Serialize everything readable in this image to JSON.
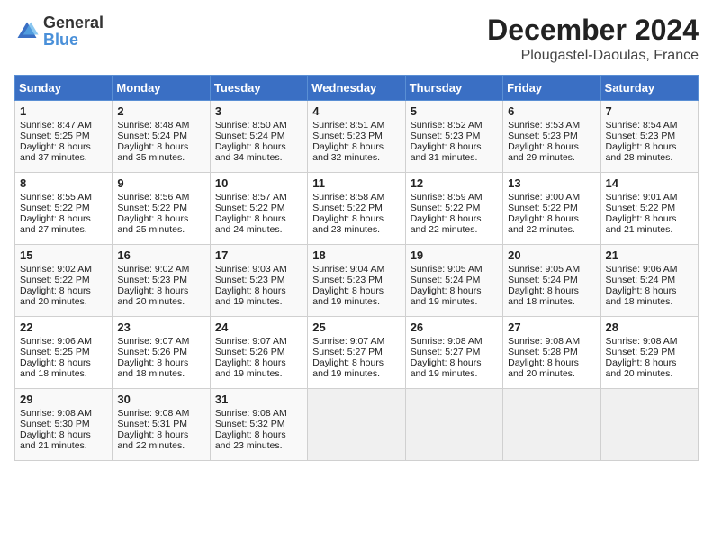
{
  "header": {
    "logo_general": "General",
    "logo_blue": "Blue",
    "month": "December 2024",
    "location": "Plougastel-Daoulas, France"
  },
  "days_of_week": [
    "Sunday",
    "Monday",
    "Tuesday",
    "Wednesday",
    "Thursday",
    "Friday",
    "Saturday"
  ],
  "weeks": [
    [
      {
        "day": 1,
        "sunrise": "8:47 AM",
        "sunset": "5:25 PM",
        "daylight": "8 hours and 37 minutes."
      },
      {
        "day": 2,
        "sunrise": "8:48 AM",
        "sunset": "5:24 PM",
        "daylight": "8 hours and 35 minutes."
      },
      {
        "day": 3,
        "sunrise": "8:50 AM",
        "sunset": "5:24 PM",
        "daylight": "8 hours and 34 minutes."
      },
      {
        "day": 4,
        "sunrise": "8:51 AM",
        "sunset": "5:23 PM",
        "daylight": "8 hours and 32 minutes."
      },
      {
        "day": 5,
        "sunrise": "8:52 AM",
        "sunset": "5:23 PM",
        "daylight": "8 hours and 31 minutes."
      },
      {
        "day": 6,
        "sunrise": "8:53 AM",
        "sunset": "5:23 PM",
        "daylight": "8 hours and 29 minutes."
      },
      {
        "day": 7,
        "sunrise": "8:54 AM",
        "sunset": "5:23 PM",
        "daylight": "8 hours and 28 minutes."
      }
    ],
    [
      {
        "day": 8,
        "sunrise": "8:55 AM",
        "sunset": "5:22 PM",
        "daylight": "8 hours and 27 minutes."
      },
      {
        "day": 9,
        "sunrise": "8:56 AM",
        "sunset": "5:22 PM",
        "daylight": "8 hours and 25 minutes."
      },
      {
        "day": 10,
        "sunrise": "8:57 AM",
        "sunset": "5:22 PM",
        "daylight": "8 hours and 24 minutes."
      },
      {
        "day": 11,
        "sunrise": "8:58 AM",
        "sunset": "5:22 PM",
        "daylight": "8 hours and 23 minutes."
      },
      {
        "day": 12,
        "sunrise": "8:59 AM",
        "sunset": "5:22 PM",
        "daylight": "8 hours and 22 minutes."
      },
      {
        "day": 13,
        "sunrise": "9:00 AM",
        "sunset": "5:22 PM",
        "daylight": "8 hours and 22 minutes."
      },
      {
        "day": 14,
        "sunrise": "9:01 AM",
        "sunset": "5:22 PM",
        "daylight": "8 hours and 21 minutes."
      }
    ],
    [
      {
        "day": 15,
        "sunrise": "9:02 AM",
        "sunset": "5:22 PM",
        "daylight": "8 hours and 20 minutes."
      },
      {
        "day": 16,
        "sunrise": "9:02 AM",
        "sunset": "5:23 PM",
        "daylight": "8 hours and 20 minutes."
      },
      {
        "day": 17,
        "sunrise": "9:03 AM",
        "sunset": "5:23 PM",
        "daylight": "8 hours and 19 minutes."
      },
      {
        "day": 18,
        "sunrise": "9:04 AM",
        "sunset": "5:23 PM",
        "daylight": "8 hours and 19 minutes."
      },
      {
        "day": 19,
        "sunrise": "9:05 AM",
        "sunset": "5:24 PM",
        "daylight": "8 hours and 19 minutes."
      },
      {
        "day": 20,
        "sunrise": "9:05 AM",
        "sunset": "5:24 PM",
        "daylight": "8 hours and 18 minutes."
      },
      {
        "day": 21,
        "sunrise": "9:06 AM",
        "sunset": "5:24 PM",
        "daylight": "8 hours and 18 minutes."
      }
    ],
    [
      {
        "day": 22,
        "sunrise": "9:06 AM",
        "sunset": "5:25 PM",
        "daylight": "8 hours and 18 minutes."
      },
      {
        "day": 23,
        "sunrise": "9:07 AM",
        "sunset": "5:26 PM",
        "daylight": "8 hours and 18 minutes."
      },
      {
        "day": 24,
        "sunrise": "9:07 AM",
        "sunset": "5:26 PM",
        "daylight": "8 hours and 19 minutes."
      },
      {
        "day": 25,
        "sunrise": "9:07 AM",
        "sunset": "5:27 PM",
        "daylight": "8 hours and 19 minutes."
      },
      {
        "day": 26,
        "sunrise": "9:08 AM",
        "sunset": "5:27 PM",
        "daylight": "8 hours and 19 minutes."
      },
      {
        "day": 27,
        "sunrise": "9:08 AM",
        "sunset": "5:28 PM",
        "daylight": "8 hours and 20 minutes."
      },
      {
        "day": 28,
        "sunrise": "9:08 AM",
        "sunset": "5:29 PM",
        "daylight": "8 hours and 20 minutes."
      }
    ],
    [
      {
        "day": 29,
        "sunrise": "9:08 AM",
        "sunset": "5:30 PM",
        "daylight": "8 hours and 21 minutes."
      },
      {
        "day": 30,
        "sunrise": "9:08 AM",
        "sunset": "5:31 PM",
        "daylight": "8 hours and 22 minutes."
      },
      {
        "day": 31,
        "sunrise": "9:08 AM",
        "sunset": "5:32 PM",
        "daylight": "8 hours and 23 minutes."
      },
      null,
      null,
      null,
      null
    ]
  ]
}
